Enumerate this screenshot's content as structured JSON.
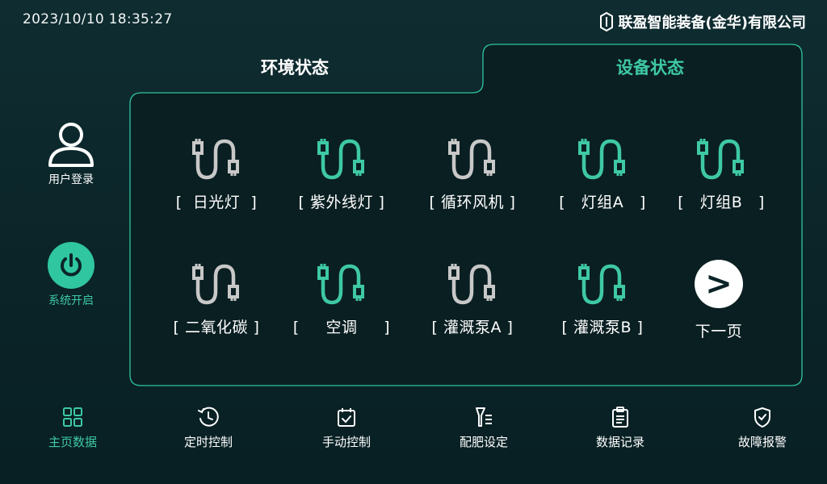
{
  "header": {
    "datetime": "2023/10/10  18:35:27",
    "brand": "联盈智能装备(金华)有限公司"
  },
  "tabs": {
    "environment": "环境状态",
    "device": "设备状态",
    "active": "device"
  },
  "sidebar": {
    "user_login": "用户登录",
    "system_start": "系统开启"
  },
  "devices": [
    {
      "label": "[  日光灯  ]",
      "on": false,
      "icon": "plug-icon"
    },
    {
      "label": "[ 紫外线灯 ]",
      "on": true,
      "icon": "plug-icon"
    },
    {
      "label": "[ 循环风机 ]",
      "on": false,
      "icon": "plug-icon"
    },
    {
      "label": "[   灯组A   ]",
      "on": true,
      "icon": "plug-icon"
    },
    {
      "label": "[   灯组B   ]",
      "on": true,
      "icon": "plug-icon"
    },
    {
      "label": "[ 二氧化碳 ]",
      "on": false,
      "icon": "plug-icon"
    },
    {
      "label": "[     空调     ]",
      "on": true,
      "icon": "plug-icon"
    },
    {
      "label": "[ 灌溉泵A ]",
      "on": false,
      "icon": "plug-icon"
    },
    {
      "label": "[ 灌溉泵B ]",
      "on": true,
      "icon": "plug-icon"
    }
  ],
  "next_page": {
    "label": "下一页",
    "symbol": ">"
  },
  "bottom_nav": [
    {
      "label": "主页数据",
      "icon": "grid-icon",
      "active": true
    },
    {
      "label": "定时控制",
      "icon": "clock-icon",
      "active": false
    },
    {
      "label": "手动控制",
      "icon": "calendar-check-icon",
      "active": false
    },
    {
      "label": "配肥设定",
      "icon": "fertilizer-icon",
      "active": false
    },
    {
      "label": "数据记录",
      "icon": "clipboard-icon",
      "active": false
    },
    {
      "label": "故障报警",
      "icon": "shield-check-icon",
      "active": false
    }
  ],
  "colors": {
    "accent": "#3ec9a3",
    "inactive_icon": "#c8c8c8",
    "background": "#0b2428",
    "text": "#ffffff"
  }
}
